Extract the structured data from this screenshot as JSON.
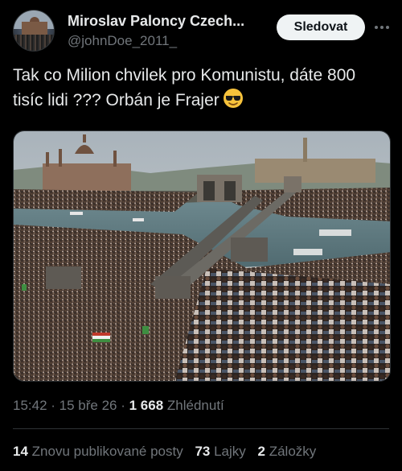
{
  "author": {
    "name": "Miroslav Paloncy Czech...",
    "handle": "@johnDoe_2011_"
  },
  "follow_button": {
    "label": "Sledovat"
  },
  "more_icon": "more-horizontal-icon",
  "tweet": {
    "text": "Tak co Milion chvilek pro Komunistu, dáte 800 tisíc lidi ??? Orbán je Frajer",
    "emoji": "sunglasses-face-icon"
  },
  "meta": {
    "time": "15:42",
    "sep1": " · ",
    "date": "15 bře 26",
    "sep2": " · ",
    "views_count": "1 668",
    "views_label": " Zhlédnutí"
  },
  "stats": {
    "reposts_count": "14",
    "reposts_label": " Znovu publikované posty",
    "likes_count": "73",
    "likes_label": " Lajky",
    "bookmarks_count": "2",
    "bookmarks_label": " Záložky"
  },
  "colors": {
    "background": "#000000",
    "text": "#e7e9ea",
    "secondary": "#71767b",
    "button_bg": "#eff3f4",
    "divider": "#2f3336"
  }
}
